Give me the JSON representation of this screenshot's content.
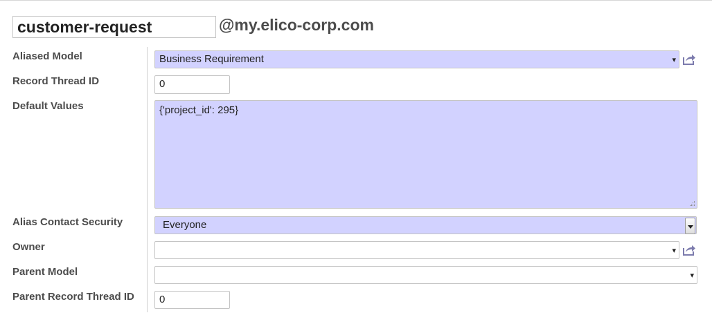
{
  "alias": {
    "name_value": "customer-request",
    "domain": "@my.elico-corp.com"
  },
  "fields": {
    "aliased_model": {
      "label": "Aliased Model",
      "value": "Business Requirement",
      "caret": "▾",
      "link_icon": "external-link-icon"
    },
    "record_thread_id": {
      "label": "Record Thread ID",
      "value": "0"
    },
    "default_values": {
      "label": "Default Values",
      "value": "{'project_id': 295}"
    },
    "alias_contact_security": {
      "label": "Alias Contact Security",
      "value": "Everyone"
    },
    "owner": {
      "label": "Owner",
      "value": "",
      "caret": "▾",
      "link_icon": "external-link-icon"
    },
    "parent_model": {
      "label": "Parent Model",
      "value": "",
      "caret": "▾"
    },
    "parent_record_thread_id": {
      "label": "Parent Record Thread ID",
      "value": "0"
    }
  },
  "colors": {
    "required_bg": "#d2d2ff",
    "link_icon": "#7c7bad",
    "label_text": "#4c4c4c"
  }
}
